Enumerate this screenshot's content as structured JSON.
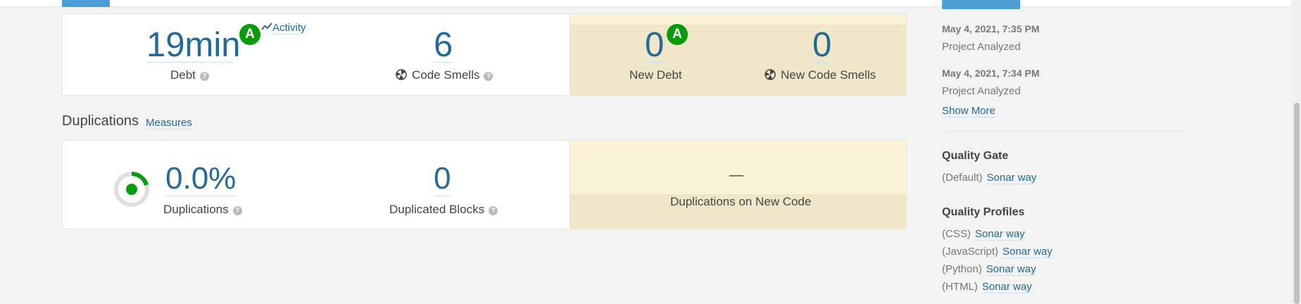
{
  "maintainability": {
    "debt_value": "19min",
    "debt_rating": "A",
    "activity_label": "Activity",
    "debt_label": "Debt",
    "code_smells_value": "6",
    "code_smells_label": "Code Smells",
    "new_debt_value": "0",
    "new_debt_rating": "A",
    "new_debt_label": "New Debt",
    "new_code_smells_value": "0",
    "new_code_smells_label": "New Code Smells"
  },
  "duplications": {
    "title": "Duplications",
    "measures_link": "Measures",
    "duplications_value": "0.0%",
    "duplications_label": "Duplications",
    "duplicated_blocks_value": "0",
    "duplicated_blocks_label": "Duplicated Blocks",
    "new_code_value": "—",
    "new_code_label": "Duplications on New Code"
  },
  "sidebar": {
    "events": [
      {
        "date": "May 4, 2021, 7:35 PM",
        "event": "Project Analyzed"
      },
      {
        "date": "May 4, 2021, 7:34 PM",
        "event": "Project Analyzed"
      }
    ],
    "show_more": "Show More",
    "quality_gate_heading": "Quality Gate",
    "quality_gate": {
      "scope": "(Default)",
      "name": "Sonar way"
    },
    "quality_profiles_heading": "Quality Profiles",
    "quality_profiles": [
      {
        "language": "(CSS)",
        "name": "Sonar way"
      },
      {
        "language": "(JavaScript)",
        "name": "Sonar way"
      },
      {
        "language": "(Python)",
        "name": "Sonar way"
      },
      {
        "language": "(HTML)",
        "name": "Sonar way"
      }
    ]
  },
  "colors": {
    "link": "#236a97",
    "rating_a": "#0a9b0a",
    "leak_period": "#fbf3d5"
  },
  "icons": [
    "help-icon",
    "code-smell-icon",
    "activity-chart-icon",
    "duplications-donut-icon"
  ]
}
